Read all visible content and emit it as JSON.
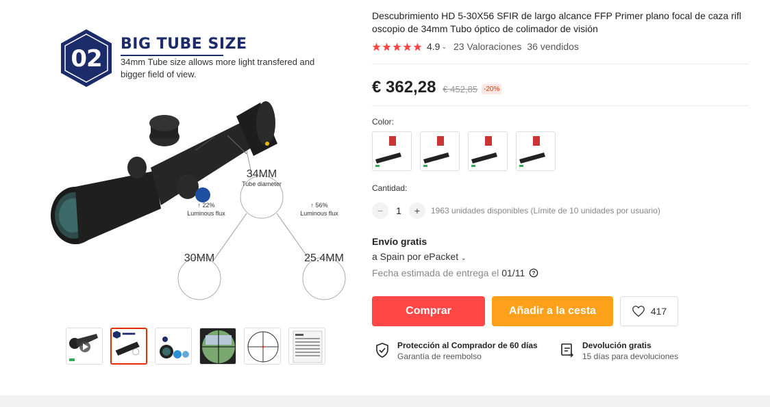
{
  "gallery": {
    "badge_number": "02",
    "promo_title": "BIG TUBE SIZE",
    "promo_desc": "34mm Tube size allows more light transfered and bigger field of view.",
    "tube_diameter": "34MM",
    "tube_diameter_caption": "Tube diameter",
    "flux_left_pct": "22%",
    "flux_right_pct": "56%",
    "flux_caption": "Luminous flux",
    "size_small": "30MM",
    "size_medium": "25.4MM",
    "thumbnails": [
      "video",
      "big-tube-size",
      "optical-design",
      "field-view",
      "reticle",
      "spec-sheet"
    ],
    "active_thumbnail": 1
  },
  "product": {
    "title": "Descubrimiento HD 5-30X56 SFIR de largo alcance FFP Primer plano focal de caza rifl oscopio de 34mm Tubo óptico de colimador de visión",
    "rating": "4.9",
    "stars": 5,
    "reviews": "23 Valoraciones",
    "sold": "36 vendidos",
    "price": "€ 362,28",
    "old_price": "€ 452,85",
    "discount": "-20%"
  },
  "options": {
    "color_label": "Color:",
    "color_count": 4,
    "quantity_label": "Cantidad:",
    "quantity": "1",
    "stock_text": "1963 unidades disponibles (Límite de 10 unidades por usuario)"
  },
  "shipping": {
    "title": "Envío gratis",
    "destination": "a Spain por ePacket",
    "delivery_label": "Fecha estimada de entrega el",
    "delivery_date": "01/11"
  },
  "actions": {
    "buy_label": "Comprar",
    "cart_label": "Añadir a la cesta",
    "wish_count": "417"
  },
  "guarantees": {
    "protection_title": "Protección al Comprador de 60 días",
    "protection_sub": "Garantía de reembolso",
    "return_title": "Devolución gratis",
    "return_sub": "15 días para devoluciones"
  },
  "colors": {
    "buy": "#ff4747",
    "cart": "#ffa01b",
    "star": "#ff4747",
    "navy": "#1c2c6a"
  }
}
